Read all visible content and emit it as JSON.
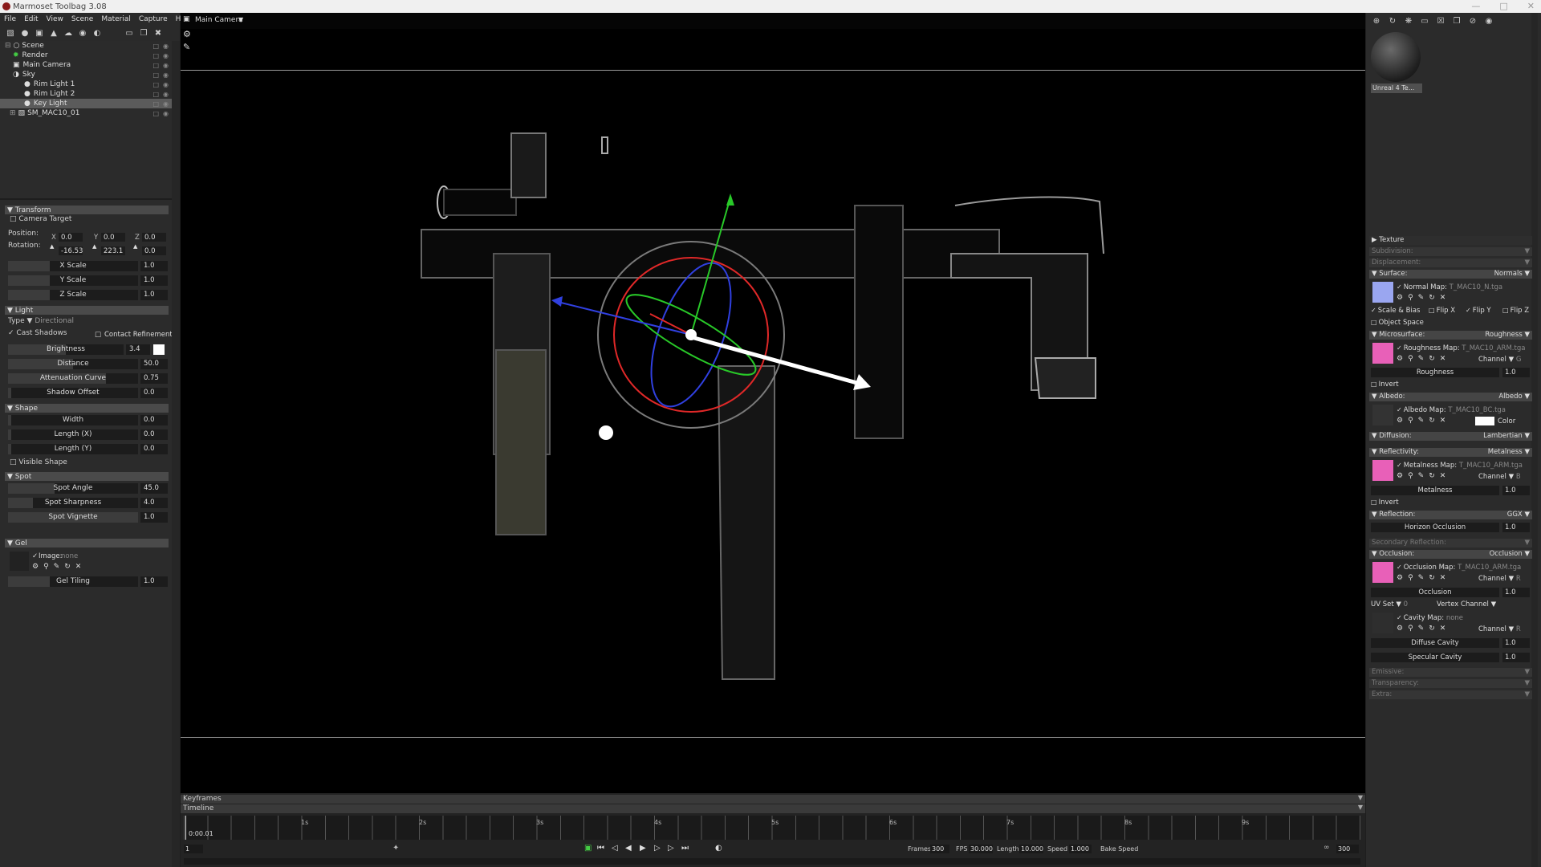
{
  "app": {
    "title": "Marmoset Toolbag 3.08"
  },
  "menu": [
    "File",
    "Edit",
    "View",
    "Scene",
    "Material",
    "Capture",
    "Help"
  ],
  "scene_tree": [
    {
      "label": "Scene",
      "indent": 0
    },
    {
      "label": "Render",
      "indent": 1
    },
    {
      "label": "Main Camera",
      "indent": 1
    },
    {
      "label": "Sky",
      "indent": 1
    },
    {
      "label": "Rim Light 1",
      "indent": 2
    },
    {
      "label": "Rim Light 2",
      "indent": 2
    },
    {
      "label": "Key Light",
      "indent": 2,
      "selected": true
    },
    {
      "label": "SM_MAC10_01",
      "indent": 1
    }
  ],
  "transform": {
    "section": "Transform",
    "camera_target": "Camera Target",
    "position_label": "Position:",
    "rotation_label": "Rotation:",
    "pos_x": "0.0",
    "pos_y": "0.0",
    "pos_z": "0.0",
    "rot_x": "-16.53",
    "rot_y": "223.1",
    "rot_z": "0.0",
    "x_label": "X",
    "y_label": "Y",
    "z_label": "Z",
    "x_scale": "X Scale",
    "y_scale": "Y Scale",
    "z_scale": "Z Scale",
    "x_scale_val": "1.0",
    "y_scale_val": "1.0",
    "z_scale_val": "1.0"
  },
  "light": {
    "section": "Light",
    "type_label": "Type",
    "type_value": "Directional",
    "cast_shadows": "Cast Shadows",
    "contact_refinement": "Contact Refinement",
    "brightness": "Brightness",
    "brightness_val": "3.4",
    "distance": "Distance",
    "distance_val": "50.0",
    "attenuation": "Attenuation Curve",
    "attenuation_val": "0.75",
    "shadow_offset": "Shadow Offset",
    "shadow_offset_val": "0.0"
  },
  "shape": {
    "section": "Shape",
    "width": "Width",
    "width_val": "0.0",
    "length_x": "Length (X)",
    "length_x_val": "0.0",
    "length_y": "Length (Y)",
    "length_y_val": "0.0",
    "visible_shape": "Visible Shape"
  },
  "spot": {
    "section": "Spot",
    "angle": "Spot Angle",
    "angle_val": "45.0",
    "sharpness": "Spot Sharpness",
    "sharpness_val": "4.0",
    "vignette": "Spot Vignette",
    "vignette_val": "1.0"
  },
  "gel": {
    "section": "Gel",
    "image_label": "Image:",
    "image_val": "none",
    "tiling": "Gel Tiling",
    "tiling_val": "1.0"
  },
  "viewport": {
    "camera": "Main Camera"
  },
  "timeline": {
    "keyframes": "Keyframes",
    "timeline": "Timeline",
    "ticks": [
      "1s",
      "2s",
      "3s",
      "4s",
      "5s",
      "6s",
      "7s",
      "8s",
      "9s"
    ],
    "time": "0:00.01",
    "frame": "1",
    "frames_label": "Frames",
    "frames_val": "300",
    "fps_label": "FPS",
    "fps_val": "30.000",
    "length_label": "Length",
    "length_val": "10.000",
    "speed_label": "Speed",
    "speed_val": "1.000",
    "bake_speed": "Bake Speed",
    "end_frame": "300"
  },
  "material": {
    "name": "Unreal 4 Te...",
    "texture": "Texture",
    "subdivision": "Subdivision:",
    "displacement": "Displacement:",
    "surface": "Surface:",
    "surface_val": "Normals",
    "normal_map": "Normal Map:",
    "normal_map_val": "T_MAC10_N.tga",
    "scale_bias": "Scale & Bias",
    "flip_x": "Flip X",
    "flip_y": "Flip Y",
    "flip_z": "Flip Z",
    "object_space": "Object Space",
    "microsurface": "Microsurface:",
    "microsurface_val": "Roughness",
    "roughness_map": "Roughness Map:",
    "roughness_map_val": "T_MAC10_ARM.tga",
    "channel": "Channel",
    "channel_g": "G",
    "channel_b": "B",
    "channel_r": "R",
    "roughness": "Roughness",
    "roughness_val": "1.0",
    "invert": "Invert",
    "albedo": "Albedo:",
    "albedo_val": "Albedo",
    "albedo_map": "Albedo Map:",
    "albedo_map_val": "T_MAC10_BC.tga",
    "color": "Color",
    "diffusion": "Diffusion:",
    "diffusion_val": "Lambertian",
    "reflectivity": "Reflectivity:",
    "reflectivity_val": "Metalness",
    "metalness_map": "Metalness Map:",
    "metalness_map_val": "T_MAC10_ARM.tga",
    "metalness": "Metalness",
    "metalness_val": "1.0",
    "reflection": "Reflection:",
    "reflection_val": "GGX",
    "horizon_occlusion": "Horizon Occlusion",
    "horizon_occlusion_val": "1.0",
    "secondary_reflection": "Secondary Reflection:",
    "occlusion": "Occlusion:",
    "occlusion_val": "Occlusion",
    "occlusion_map": "Occlusion Map:",
    "occlusion_map_val": "T_MAC10_ARM.tga",
    "occlusion_label": "Occlusion",
    "occlusion_num": "1.0",
    "uv_set": "UV Set",
    "uv_set_val": "0",
    "vertex_channel": "Vertex Channel",
    "cavity_map": "Cavity Map:",
    "cavity_map_val": "none",
    "diffuse_cavity": "Diffuse Cavity",
    "diffuse_cavity_val": "1.0",
    "specular_cavity": "Specular Cavity",
    "specular_cavity_val": "1.0",
    "emissive": "Emissive:",
    "transparency": "Transparency:",
    "extra": "Extra:"
  },
  "colors": {
    "accent": "#e0e0e0",
    "gizmo_red": "#e02828",
    "gizmo_green": "#28c828",
    "gizmo_blue": "#3040e0",
    "map_pink": "#e860b8"
  }
}
